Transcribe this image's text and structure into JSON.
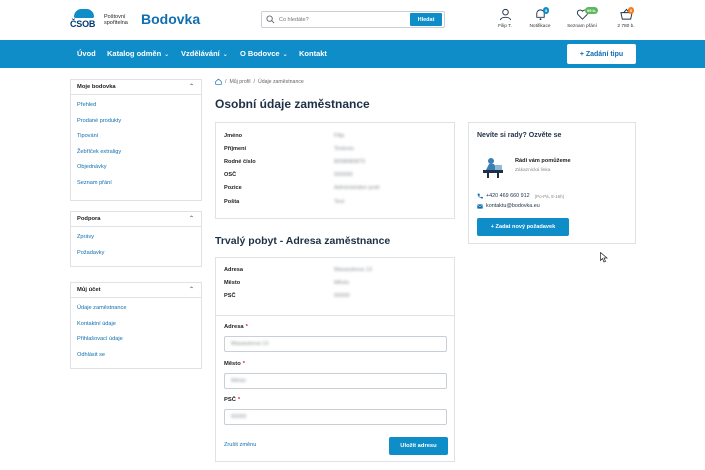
{
  "header": {
    "logo_text": "ČSOB",
    "logo_sub": "Poštovní spořitelna",
    "brand": "Bodovka",
    "search_placeholder": "Co hledáte?",
    "search_button": "Hledat",
    "icons": [
      {
        "label": "Filip T.",
        "icon": "user-icon"
      },
      {
        "label": "Notifikace",
        "icon": "bell-icon",
        "badge": "9"
      },
      {
        "label": "Seznam přání",
        "icon": "heart-icon",
        "badge": "99 b."
      },
      {
        "label": "2 780 b.",
        "icon": "basket-icon",
        "badge": "0"
      }
    ]
  },
  "nav": {
    "items": [
      "Úvod",
      "Katalog odměn",
      "Vzdělávání",
      "O Bodovce",
      "Kontakt"
    ],
    "tip_button": "+ Zadání tipu"
  },
  "sidebar": {
    "groups": [
      {
        "title": "Moje bodovka",
        "items": [
          "Přehled",
          "Prodané produkty",
          "Tipování",
          "Žebříček extraligy",
          "Objednávky",
          "Seznam přání"
        ]
      },
      {
        "title": "Podpora",
        "items": [
          "Zprávy",
          "Požadavky"
        ]
      },
      {
        "title": "Můj účet",
        "items": [
          "Údaje zaměstnance",
          "Kontaktní údaje",
          "Přihlašovací údaje",
          "Odhlásit se"
        ]
      }
    ]
  },
  "breadcrumb": [
    "Můj profil",
    "Údaje zaměstnance"
  ],
  "personal": {
    "title": "Osobní údaje zaměstnance",
    "fields": [
      {
        "label": "Jméno",
        "value": "Filip"
      },
      {
        "label": "Příjmení",
        "value": "Testovic"
      },
      {
        "label": "Rodné číslo",
        "value": "8008080875"
      },
      {
        "label": "OSČ",
        "value": "000000"
      },
      {
        "label": "Pozice",
        "value": "Administrátor podr"
      },
      {
        "label": "Pošta",
        "value": "Test"
      }
    ]
  },
  "address": {
    "title": "Trvalý pobyt - Adresa zaměstnance",
    "fields": [
      {
        "label": "Adresa",
        "value": "Masarykova 13"
      },
      {
        "label": "Město",
        "value": "Město"
      },
      {
        "label": "PSČ",
        "value": "00000"
      }
    ],
    "form": {
      "street_label": "Adresa",
      "street_value": "Masarykova 13",
      "city_label": "Město",
      "city_value": "Město",
      "zip_label": "PSČ",
      "zip_value": "00000",
      "required_mark": "*",
      "cancel": "Zrušit změnu",
      "save": "Uložit adresu"
    }
  },
  "help": {
    "title": "Nevíte si rady? Ozvěte se",
    "name": "Rádi vám pomůžeme",
    "role": "Zákaznická linka",
    "phone": "+420 469 660 912",
    "hours": "(Po-Pá, 8-16h)",
    "email": "kontaktu@bodovka.eu",
    "button": "+ Zadat nový požadavek"
  },
  "colors": {
    "accent": "#0f8dc9",
    "link": "#0f6fb0",
    "heading": "#1d3045"
  }
}
